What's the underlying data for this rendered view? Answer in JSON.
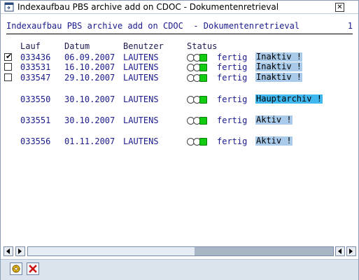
{
  "window": {
    "title": "Indexaufbau PBS archive add on CDOC - Dokumentenretrieval"
  },
  "report": {
    "heading": "Indexaufbau PBS archive add on CDOC  - Dokumentenretrieval",
    "page_number": "1",
    "columns": {
      "lauf": "Lauf",
      "datum": "Datum",
      "benutzer": "Benutzer",
      "status": "Status"
    },
    "rows": [
      {
        "checked": true,
        "has_checkbox": true,
        "lauf": "033436",
        "datum": "06.09.2007",
        "benutzer": "LAUTENS",
        "status": "fertig",
        "tag": "Inaktiv !",
        "tag_color": "#a9cbe9"
      },
      {
        "checked": false,
        "has_checkbox": true,
        "lauf": "033531",
        "datum": "16.10.2007",
        "benutzer": "LAUTENS",
        "status": "fertig",
        "tag": "Inaktiv !",
        "tag_color": "#a9cbe9"
      },
      {
        "checked": false,
        "has_checkbox": true,
        "lauf": "033547",
        "datum": "29.10.2007",
        "benutzer": "LAUTENS",
        "status": "fertig",
        "tag": "Inaktiv !",
        "tag_color": "#a9cbe9"
      },
      {
        "checked": false,
        "has_checkbox": false,
        "lauf": "033550",
        "datum": "30.10.2007",
        "benutzer": "LAUTENS",
        "status": "fertig",
        "tag": "Hauptarchiv !",
        "tag_color": "#3fb8f0"
      },
      {
        "checked": false,
        "has_checkbox": false,
        "lauf": "033551",
        "datum": "30.10.2007",
        "benutzer": "LAUTENS",
        "status": "fertig",
        "tag": "Aktiv !",
        "tag_color": "#a9cbe9"
      },
      {
        "checked": false,
        "has_checkbox": false,
        "lauf": "033556",
        "datum": "01.11.2007",
        "benutzer": "LAUTENS",
        "status": "fertig",
        "tag": "Aktiv !",
        "tag_color": "#a9cbe9"
      }
    ]
  },
  "traffic_light": {
    "off_color": "#ffffff",
    "on_color": "#11cc11"
  },
  "footer": {
    "buttons": [
      "continue-icon",
      "cancel-icon"
    ]
  }
}
